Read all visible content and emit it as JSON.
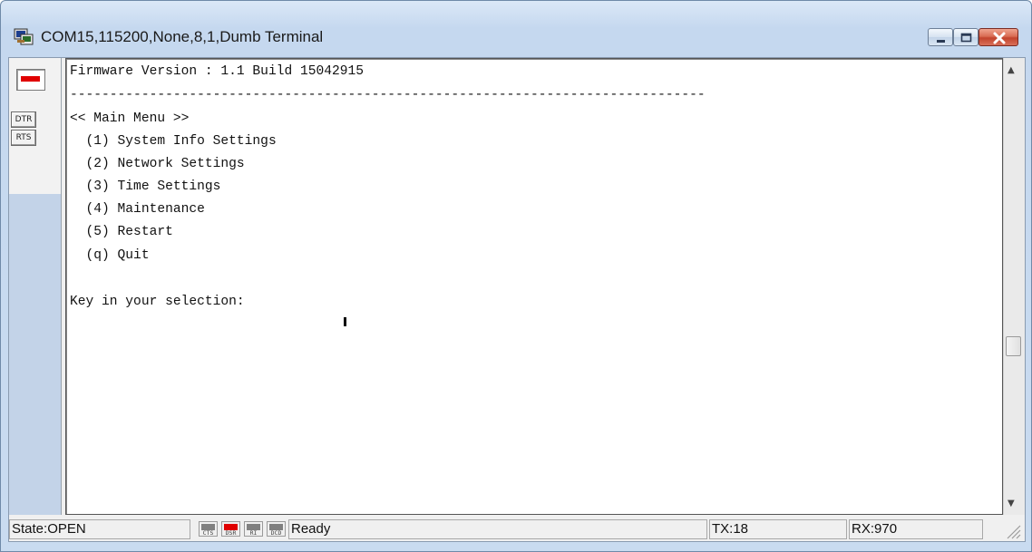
{
  "window": {
    "title": "COM15,115200,None,8,1,Dumb Terminal",
    "controls": {
      "minimize_icon": "minimize-icon",
      "maximize_icon": "maximize-icon",
      "close_icon": "close-icon"
    }
  },
  "sidebar": {
    "connection_led_color": "#e00000",
    "buttons": [
      {
        "label": "DTR"
      },
      {
        "label": "RTS"
      }
    ]
  },
  "terminal": {
    "lines": [
      "Firmware Version : 1.1 Build 15042915",
      "--------------------------------------------------------------------------------",
      "<< Main Menu >>",
      "  (1) System Info Settings",
      "  (2) Network Settings",
      "  (3) Time Settings",
      "  (4) Maintenance",
      "  (5) Restart",
      "  (q) Quit",
      "",
      "Key in your selection:"
    ]
  },
  "statusbar": {
    "state": "State:OPEN",
    "indicators": [
      {
        "label": "CTS",
        "color": "#808080"
      },
      {
        "label": "DSR",
        "color": "#e00000"
      },
      {
        "label": "RI",
        "color": "#808080"
      },
      {
        "label": "DCD",
        "color": "#808080"
      }
    ],
    "status": "Ready",
    "tx": "TX:18",
    "rx": "RX:970"
  }
}
